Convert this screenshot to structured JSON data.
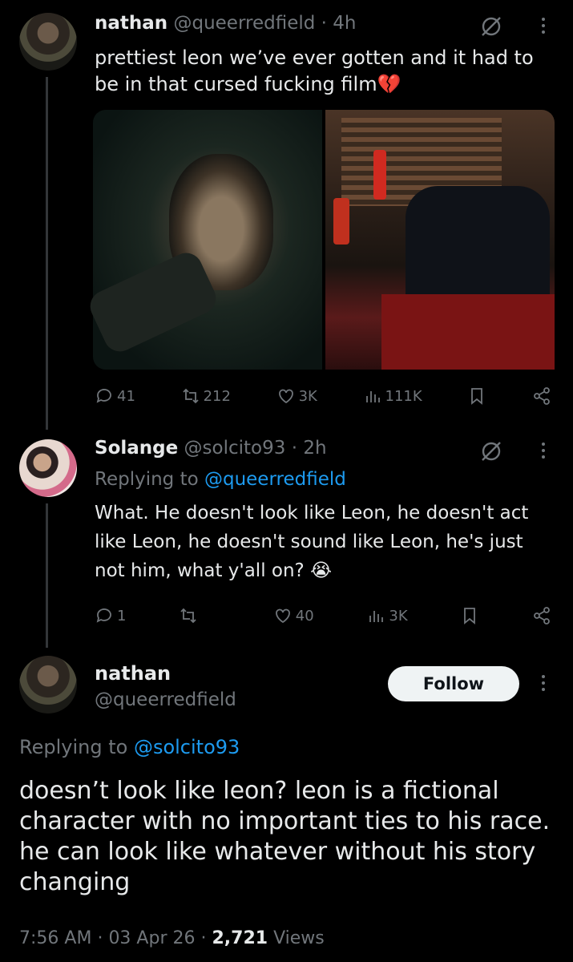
{
  "tweet1": {
    "display_name": "nathan",
    "handle": "@queerredfield",
    "sep": "·",
    "time": "4h",
    "text": "prettiest leon we’ve ever gotten and it had to be in that cursed fucking film💔",
    "replies": "41",
    "retweets": "212",
    "likes": "3K",
    "views": "111K"
  },
  "tweet2": {
    "display_name": "Solange",
    "handle": "@solcito93",
    "sep": "·",
    "time": "2h",
    "replying_prefix": "Replying to",
    "replying_to": "@queerredfield",
    "text": "What. He doesn't look like Leon, he doesn't act like Leon, he doesn't sound like Leon, he's just not him, what y'all on? 😭",
    "replies": "1",
    "retweets": "",
    "likes": "40",
    "views": "3K"
  },
  "main": {
    "display_name": "nathan",
    "handle": "@queerredfield",
    "follow_label": "Follow",
    "replying_prefix": "Replying to",
    "replying_to": "@solcito93",
    "text": "doesn’t look like leon? leon is a fictional character with no important ties to his race. he can look like whatever without his story changing",
    "time": "7:56 AM",
    "sep1": "·",
    "date": "03 Apr 26",
    "sep2": "·",
    "views_count": "2,721",
    "views_label": "Views"
  }
}
